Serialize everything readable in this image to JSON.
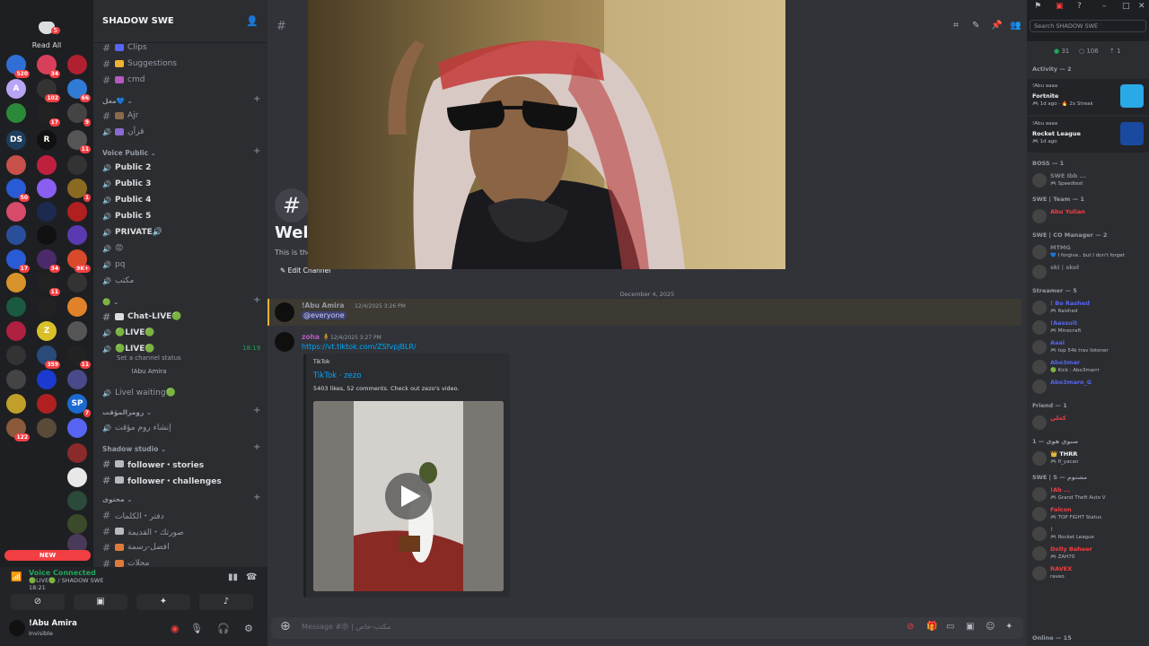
{
  "rail": {
    "read_all": "Read All",
    "new_label": "NEW",
    "servers": [
      {
        "label": "",
        "badge": "520",
        "color": "#2f6fd6"
      },
      {
        "label": "",
        "badge": "34",
        "color": "#d83f5a"
      },
      {
        "label": "",
        "badge": "",
        "color": "#b02030"
      },
      {
        "label": "A",
        "badge": "",
        "color": "#b9a5f5"
      },
      {
        "label": "",
        "badge": "102",
        "color": "#333"
      },
      {
        "label": "",
        "badge": "66",
        "color": "#2f7bd6"
      },
      {
        "label": "",
        "badge": "",
        "color": "#2a8a3a"
      },
      {
        "label": "",
        "badge": "17",
        "color": "#222"
      },
      {
        "label": "",
        "badge": "9",
        "color": "#444"
      },
      {
        "label": "DS",
        "badge": "",
        "color": "#1f3d5c"
      },
      {
        "label": "R",
        "badge": "",
        "color": "#111"
      },
      {
        "label": "",
        "badge": "11",
        "color": "#555"
      },
      {
        "label": "",
        "badge": "",
        "color": "#c8504a"
      },
      {
        "label": "",
        "badge": "",
        "color": "#c02040"
      },
      {
        "label": "",
        "badge": "",
        "color": "#333"
      },
      {
        "label": "",
        "badge": "50",
        "color": "#2a5bd6"
      },
      {
        "label": "",
        "badge": "",
        "color": "#8a5ef0"
      },
      {
        "label": "",
        "badge": "1",
        "color": "#8a6a20"
      },
      {
        "label": "",
        "badge": "",
        "color": "#d84a6a"
      },
      {
        "label": "",
        "badge": "",
        "color": "#1c2a50"
      },
      {
        "label": "",
        "badge": "",
        "color": "#b02020"
      },
      {
        "label": "",
        "badge": "",
        "color": "#2a4f9a"
      },
      {
        "label": "",
        "badge": "",
        "color": "#111"
      },
      {
        "label": "",
        "badge": "",
        "color": "#5a3ab0"
      },
      {
        "label": "",
        "badge": "17",
        "color": "#2a5bd6"
      },
      {
        "label": "",
        "badge": "34",
        "color": "#4a2a6a"
      },
      {
        "label": "",
        "badge": "9K+",
        "color": "#d84a2a"
      },
      {
        "label": "",
        "badge": "",
        "color": "#d8942a"
      },
      {
        "label": "",
        "badge": "11",
        "color": "#222"
      },
      {
        "label": "",
        "badge": "",
        "color": "#333"
      },
      {
        "label": "",
        "badge": "",
        "color": "#1a5a40"
      },
      {
        "label": "",
        "badge": "",
        "color": "#222"
      },
      {
        "label": "",
        "badge": "",
        "color": "#e0822a"
      },
      {
        "label": "",
        "badge": "",
        "color": "#b02040"
      },
      {
        "label": "Z",
        "badge": "",
        "color": "#d8c02a"
      },
      {
        "label": "",
        "badge": "",
        "color": "#555"
      },
      {
        "label": "",
        "badge": "",
        "color": "#333"
      },
      {
        "label": "",
        "badge": "359",
        "color": "#2a4a7a"
      },
      {
        "label": "",
        "badge": "11",
        "color": "#222"
      },
      {
        "label": "",
        "badge": "",
        "color": "#444"
      },
      {
        "label": "",
        "badge": "",
        "color": "#1a3ad0"
      },
      {
        "label": "",
        "badge": "",
        "color": "#4a4a8a"
      },
      {
        "label": "",
        "badge": "",
        "color": "#c0a02a"
      },
      {
        "label": "",
        "badge": "",
        "color": "#b02020"
      },
      {
        "label": "SP",
        "badge": "7",
        "color": "#1a6ad0"
      },
      {
        "label": "",
        "badge": "122",
        "color": "#8a5a3a"
      },
      {
        "label": "",
        "badge": "",
        "color": "#5a4a3a"
      },
      {
        "label": "",
        "badge": "",
        "color": "#5865f2"
      }
    ],
    "folder": [
      {
        "color": "#8a2a2a"
      },
      {
        "color": "#e8e8e8"
      },
      {
        "color": "#2a4a3a"
      },
      {
        "color": "#3a4a2a"
      },
      {
        "color": "#4a3a5a"
      }
    ]
  },
  "guild": {
    "name": "SHADOW SWE",
    "categories": [
      {
        "label": "معل💙"
      },
      {
        "label": "Voice Public"
      },
      {
        "label": "🟢"
      },
      {
        "label": "رومزالمؤقت"
      },
      {
        "label": "Shadow studio"
      },
      {
        "label": "محتوى"
      }
    ],
    "channels": [
      {
        "label": "Clips",
        "type": "text",
        "emoji_color": "#5865f2"
      },
      {
        "label": "Suggestions",
        "type": "text",
        "emoji_color": "#f0b232"
      },
      {
        "label": "cmd",
        "type": "text",
        "emoji_color": "#b45ac0"
      },
      {
        "label": "Ajr",
        "type": "text",
        "emoji_color": "#8a6a4a"
      },
      {
        "label": "قرآن",
        "type": "voice",
        "emoji_color": "#8a6ad0"
      },
      {
        "label": "Public 2",
        "type": "voice",
        "emoji_color": ""
      },
      {
        "label": "Public 3",
        "type": "voice",
        "emoji_color": ""
      },
      {
        "label": "Public 4",
        "type": "voice",
        "emoji_color": ""
      },
      {
        "label": "Public 5",
        "type": "voice",
        "emoji_color": ""
      },
      {
        "label": "PRIVATE🔊",
        "type": "voice",
        "emoji_color": ""
      },
      {
        "label": "😡",
        "type": "voice",
        "emoji_color": ""
      },
      {
        "label": "pq",
        "type": "voice",
        "emoji_color": ""
      },
      {
        "label": "مكتب",
        "type": "voice",
        "emoji_color": ""
      },
      {
        "label": "Chat-LIVE🟢",
        "type": "text",
        "emoji_color": "#dbdee1"
      },
      {
        "label": "🟢LIVE🟢",
        "type": "voice",
        "emoji_color": ""
      },
      {
        "label": "🟢LIVE🟢",
        "type": "voice",
        "emoji_color": ""
      },
      {
        "label": "Livel waiting🟢",
        "type": "voice",
        "emoji_color": ""
      },
      {
        "label": "إنشاء روم مؤقت",
        "type": "voice",
        "emoji_color": ""
      },
      {
        "label": "follower・stories",
        "type": "text",
        "emoji_color": "#b5bac1"
      },
      {
        "label": "follower・challenges",
        "type": "text",
        "emoji_color": "#b5bac1"
      },
      {
        "label": "دفتر・الكلمات",
        "type": "text",
        "emoji_color": ""
      },
      {
        "label": "صورتك・القديمة",
        "type": "text",
        "emoji_color": "#b5bac1"
      },
      {
        "label": "افضل-رسمة",
        "type": "text",
        "emoji_color": "#e07a3a"
      },
      {
        "label": "محلات",
        "type": "text",
        "emoji_color": "#e07a3a"
      }
    ],
    "live_time": "18:19",
    "live_status": "Set a channel status",
    "live_member": "!Abu Amira"
  },
  "voice_panel": {
    "title": "Voice Connected",
    "sub": "🟢LIVE🟢 / SHADOW SWE",
    "time": "18:21"
  },
  "user": {
    "name": "!Abu Amira",
    "status": "Invisible"
  },
  "chat": {
    "welcome": "Welc",
    "welcome_sub": "This is the",
    "edit_channel": "Edit Channel",
    "date": "December 4, 2025",
    "msg1_name": "!Abu Amira",
    "msg1_time": "12/4/2025 3:26 PM",
    "msg1_text": "@everyone",
    "msg2_name": "zoha 🧍",
    "msg2_time": "12/4/2025 3:27 PM",
    "msg2_link": "https://vt.tiktok.com/ZSfvpjBLR/",
    "embed_provider": "TikTok",
    "embed_title": "TikTok · zezo",
    "embed_desc": "5403 likes, 52 comments. Check out zezo's video.",
    "composer_placeholder": "Message #😡 | مكتب-خاص"
  },
  "members": {
    "search_placeholder": "Search SHADOW SWE",
    "online": "31",
    "offline": "106",
    "boosts": "1",
    "activity_header": "Activity — 2",
    "activities": [
      {
        "user": "!Abu aaaa",
        "game": "Fortnite",
        "sub": "🎮 1d ago · 🔥 2x Streak",
        "icon": "#2aa9e8"
      },
      {
        "user": "!Abu aaaa",
        "game": "Rocket League",
        "sub": "🎮 1d ago",
        "icon": "#1a4aa0"
      }
    ],
    "groups": [
      {
        "title": "BOSS — 1",
        "items": [
          {
            "name": "SWE Ibb ...",
            "sub": "🎮 Speedtest",
            "color": "#80848e"
          }
        ]
      },
      {
        "title": "SWE | Team — 1",
        "items": [
          {
            "name": "Abu Yulian",
            "sub": "",
            "color": "#f23f43"
          }
        ]
      },
      {
        "title": "SWE | CO Manager — 2",
        "items": [
          {
            "name": "MTMG",
            "sub": "💙 I forgive.. but I don't forget",
            "color": "#80848e"
          },
          {
            "name": "ski | skol",
            "sub": "",
            "color": "#80848e"
          }
        ]
      },
      {
        "title": "Streamer — 5",
        "items": [
          {
            "name": "! Bo Rashed",
            "sub": "🎮 Raished",
            "color": "#5865f2"
          },
          {
            "name": "!Aassuit",
            "sub": "🎮 Minecraft",
            "color": "#5865f2"
          },
          {
            "name": "Aaai",
            "sub": "🎮 top 54k trav listener",
            "color": "#5865f2"
          },
          {
            "name": "Abo3mar",
            "sub": "🟢 Kick : Abo3marrr",
            "color": "#5865f2"
          },
          {
            "name": "Abo3maro_G",
            "sub": "",
            "color": "#5865f2"
          }
        ]
      },
      {
        "title": "Friend — 1",
        "items": [
          {
            "name": "كحلي",
            "sub": "",
            "color": "#f23f43"
          }
        ]
      },
      {
        "title": "صبوي هوى — 1",
        "items": [
          {
            "name": "👑 THRR",
            "sub": "🎮 fl_yacan",
            "color": "#f2f3f5"
          }
        ]
      },
      {
        "title": "SWE | S — مشتوم",
        "items": [
          {
            "name": "!Ab ...",
            "sub": "🎮 Grand Theft Auto V",
            "color": "#f23f43"
          },
          {
            "name": "Falcon",
            "sub": "🎮 TOP FIGHT Status",
            "color": "#f23f43"
          },
          {
            "name": "!",
            "sub": "🎮 Rocket League",
            "color": "#f23f43"
          },
          {
            "name": "Dolly Baheer",
            "sub": "🎮 ZAH70",
            "color": "#f23f43"
          },
          {
            "name": "RAVEX",
            "sub": "raveo",
            "color": "#f23f43"
          }
        ]
      }
    ],
    "offline_header": "Online — 15"
  }
}
